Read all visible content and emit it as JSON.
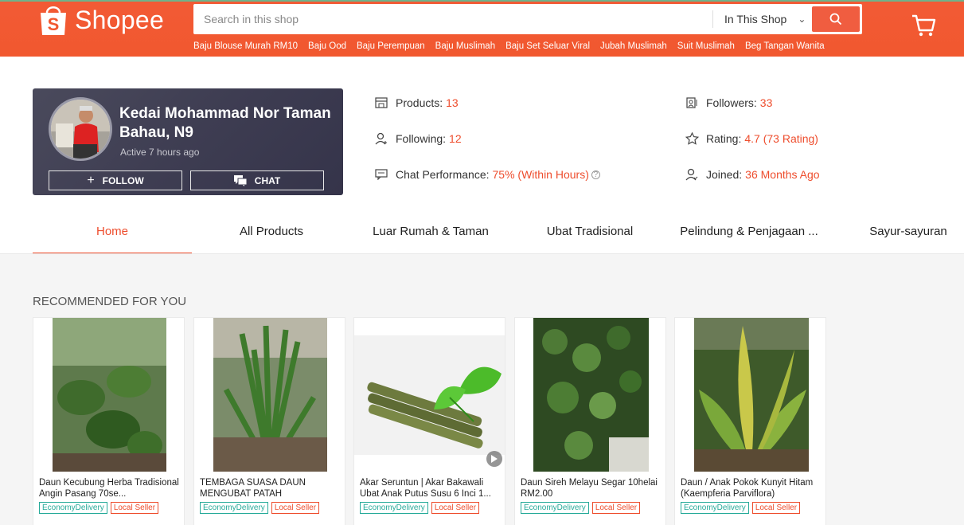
{
  "header": {
    "logo_text": "Shopee",
    "search_placeholder": "Search in this shop",
    "search_scope": "In This Shop",
    "hot_words": [
      "Baju Blouse Murah RM10",
      "Baju Ood",
      "Baju Perempuan",
      "Baju Muslimah",
      "Baju Set Seluar Viral",
      "Jubah Muslimah",
      "Suit Muslimah",
      "Beg Tangan Wanita"
    ]
  },
  "shop": {
    "name": "Kedai Mohammad Nor Taman Bahau, N9",
    "active": "Active 7 hours ago",
    "follow_label": "FOLLOW",
    "chat_label": "CHAT"
  },
  "stats": {
    "products_label": "Products:",
    "products_value": "13",
    "following_label": "Following:",
    "following_value": "12",
    "chat_label": "Chat Performance:",
    "chat_value": "75% (Within Hours)",
    "followers_label": "Followers:",
    "followers_value": "33",
    "rating_label": "Rating:",
    "rating_value": "4.7 (73 Rating)",
    "joined_label": "Joined:",
    "joined_value": "36 Months Ago"
  },
  "tabs": [
    "Home",
    "All Products",
    "Luar Rumah & Taman",
    "Ubat Tradisional",
    "Pelindung & Penjagaan ...",
    "Sayur-sayuran"
  ],
  "section_title": "RECOMMENDED FOR YOU",
  "products": [
    {
      "title": "Daun Kecubung Herba Tradisional Angin Pasang 70se...",
      "eco": "EconomyDelivery",
      "local": "Local Seller"
    },
    {
      "title": "TEMBAGA SUASA DAUN MENGUBAT PATAH",
      "eco": "EconomyDelivery",
      "local": "Local Seller"
    },
    {
      "title": "Akar Seruntun | Akar Bakawali Ubat Anak Putus Susu 6 Inci 1...",
      "eco": "EconomyDelivery",
      "local": "Local Seller"
    },
    {
      "title": "Daun Sireh Melayu Segar 10helai RM2.00",
      "eco": "EconomyDelivery",
      "local": "Local Seller"
    },
    {
      "title": "Daun / Anak Pokok Kunyit Hitam (Kaempferia Parviflora)",
      "eco": "EconomyDelivery",
      "local": "Local Seller"
    }
  ],
  "colors": {
    "brand": "#ee4d2d",
    "header": "#f1582f",
    "eco": "#26aa99"
  }
}
